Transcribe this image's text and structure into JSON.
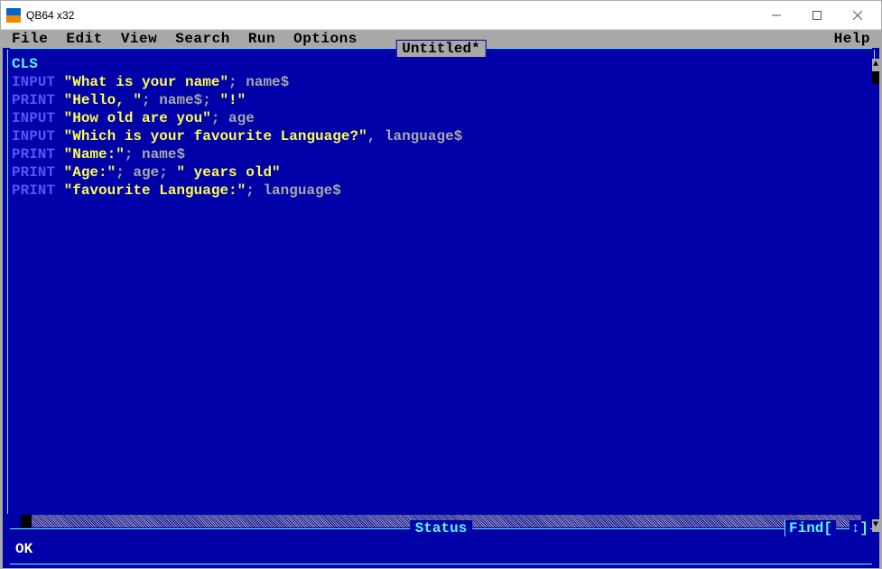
{
  "window": {
    "title": "QB64 x32"
  },
  "menubar": {
    "items": [
      "File",
      "Edit",
      "View",
      "Search",
      "Run",
      "Options"
    ],
    "right": "Help"
  },
  "document": {
    "title": "Untitled*"
  },
  "code": [
    [
      {
        "cls": "kw-cls",
        "t": "CLS"
      }
    ],
    [
      {
        "cls": "kw",
        "t": "INPUT "
      },
      {
        "cls": "str",
        "t": "\"What is your name\""
      },
      {
        "cls": "punc",
        "t": "; "
      },
      {
        "cls": "var",
        "t": "name$"
      }
    ],
    [
      {
        "cls": "kw",
        "t": "PRINT "
      },
      {
        "cls": "str",
        "t": "\"Hello, \""
      },
      {
        "cls": "punc",
        "t": "; "
      },
      {
        "cls": "var",
        "t": "name$"
      },
      {
        "cls": "punc",
        "t": "; "
      },
      {
        "cls": "str",
        "t": "\"!\""
      }
    ],
    [
      {
        "cls": "kw",
        "t": "INPUT "
      },
      {
        "cls": "str",
        "t": "\"How old are you\""
      },
      {
        "cls": "punc",
        "t": "; "
      },
      {
        "cls": "var",
        "t": "age"
      }
    ],
    [
      {
        "cls": "kw",
        "t": "INPUT "
      },
      {
        "cls": "str",
        "t": "\"Which is your favourite Language?\""
      },
      {
        "cls": "punc",
        "t": ", "
      },
      {
        "cls": "var",
        "t": "language$"
      }
    ],
    [
      {
        "cls": "kw",
        "t": "PRINT "
      },
      {
        "cls": "str",
        "t": "\"Name:\""
      },
      {
        "cls": "punc",
        "t": "; "
      },
      {
        "cls": "var",
        "t": "name$"
      }
    ],
    [
      {
        "cls": "kw",
        "t": "PRINT "
      },
      {
        "cls": "str",
        "t": "\"Age:\""
      },
      {
        "cls": "punc",
        "t": "; "
      },
      {
        "cls": "var",
        "t": "age"
      },
      {
        "cls": "punc",
        "t": "; "
      },
      {
        "cls": "str",
        "t": "\" years old\""
      }
    ],
    [
      {
        "cls": "kw",
        "t": "PRINT "
      },
      {
        "cls": "str",
        "t": "\"favourite Language:\""
      },
      {
        "cls": "punc",
        "t": "; "
      },
      {
        "cls": "var",
        "t": "language$"
      }
    ]
  ],
  "status": {
    "label": "Status",
    "find": "Find[",
    "updown": "↕]",
    "message": "OK"
  },
  "colors": {
    "background": "#0000a8",
    "menubar": "#a8a8a8",
    "border": "#54fcfc",
    "keyword": "#5454fc",
    "string": "#fcfc54",
    "variable": "#a8a8a8"
  }
}
